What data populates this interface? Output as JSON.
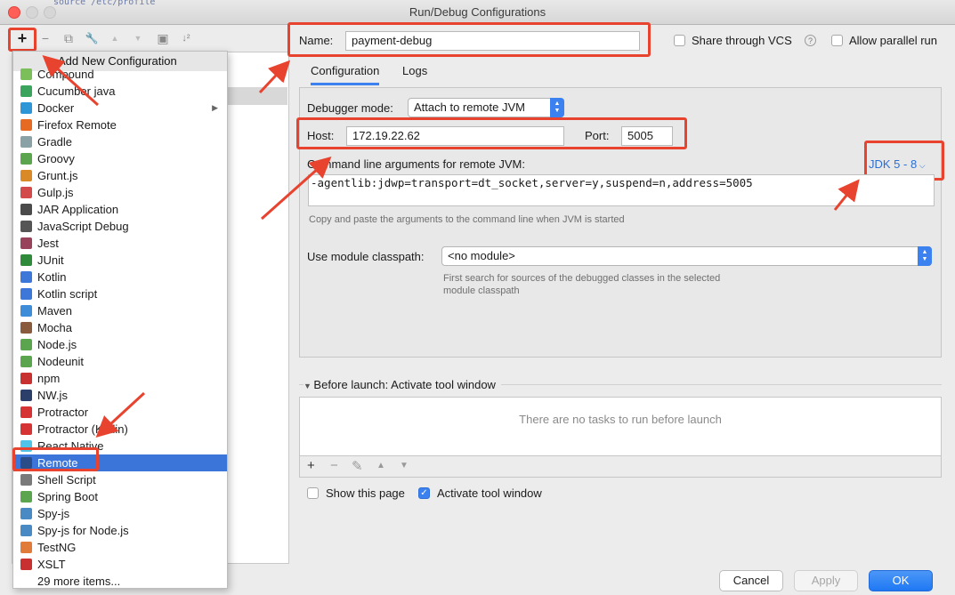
{
  "window": {
    "title": "Run/Debug Configurations",
    "bg_text": "source /etc/profile"
  },
  "toolbar": {
    "add": "+",
    "remove": "−",
    "copy": "⧉",
    "wrench": "🔧",
    "up": "▲",
    "down": "▼",
    "folder": "▣",
    "sort": "↓²"
  },
  "dropdown": {
    "header": "Add New Configuration",
    "items": [
      {
        "label": "Compound",
        "icon": "compound-icon",
        "color": "#7bbf5a"
      },
      {
        "label": "Cucumber java",
        "icon": "cucumber-icon",
        "color": "#3aa35c"
      },
      {
        "label": "Docker",
        "icon": "docker-icon",
        "color": "#2c96d6",
        "submenu": "▶"
      },
      {
        "label": "Firefox Remote",
        "icon": "firefox-icon",
        "color": "#e76a22"
      },
      {
        "label": "Gradle",
        "icon": "gradle-icon",
        "color": "#8aa1a6"
      },
      {
        "label": "Groovy",
        "icon": "groovy-icon",
        "color": "#5aa54d"
      },
      {
        "label": "Grunt.js",
        "icon": "grunt-icon",
        "color": "#d98a26"
      },
      {
        "label": "Gulp.js",
        "icon": "gulp-icon",
        "color": "#d24a4a"
      },
      {
        "label": "JAR Application",
        "icon": "jar-icon",
        "color": "#4b4b4b"
      },
      {
        "label": "JavaScript Debug",
        "icon": "js-debug-icon",
        "color": "#555"
      },
      {
        "label": "Jest",
        "icon": "jest-icon",
        "color": "#99425b"
      },
      {
        "label": "JUnit",
        "icon": "junit-icon",
        "color": "#2f8a3a"
      },
      {
        "label": "Kotlin",
        "icon": "kotlin-icon",
        "color": "#3d78d8"
      },
      {
        "label": "Kotlin script",
        "icon": "kotlin-script-icon",
        "color": "#3d78d8"
      },
      {
        "label": "Maven",
        "icon": "maven-icon",
        "color": "#3d8dd8"
      },
      {
        "label": "Mocha",
        "icon": "mocha-icon",
        "color": "#8a5a3c"
      },
      {
        "label": "Node.js",
        "icon": "nodejs-icon",
        "color": "#5aa54d"
      },
      {
        "label": "Nodeunit",
        "icon": "nodeunit-icon",
        "color": "#5aa54d"
      },
      {
        "label": "npm",
        "icon": "npm-icon",
        "color": "#c93030"
      },
      {
        "label": "NW.js",
        "icon": "nwjs-icon",
        "color": "#2c3e6a"
      },
      {
        "label": "Protractor",
        "icon": "protractor-icon",
        "color": "#d63434"
      },
      {
        "label": "Protractor (Kotlin)",
        "icon": "protractor-kotlin-icon",
        "color": "#d63434"
      },
      {
        "label": "React Native",
        "icon": "react-icon",
        "color": "#4fc3e8"
      },
      {
        "label": "Remote",
        "icon": "remote-icon",
        "color": "#2a4d8a",
        "selected": true
      },
      {
        "label": "Shell Script",
        "icon": "shell-icon",
        "color": "#7a7a7a"
      },
      {
        "label": "Spring Boot",
        "icon": "spring-icon",
        "color": "#5aa54d"
      },
      {
        "label": "Spy-js",
        "icon": "spyjs-icon",
        "color": "#4a8ac4"
      },
      {
        "label": "Spy-js for Node.js",
        "icon": "spyjs-node-icon",
        "color": "#4a8ac4"
      },
      {
        "label": "TestNG",
        "icon": "testng-icon",
        "color": "#e07b3a"
      },
      {
        "label": "XSLT",
        "icon": "xslt-icon",
        "color": "#c93030"
      },
      {
        "label": "29 more items...",
        "icon": "",
        "color": ""
      }
    ]
  },
  "name_row": {
    "label": "Name:",
    "value": "payment-debug",
    "share_vcs": "Share through VCS",
    "help": "?",
    "allow_parallel": "Allow parallel run"
  },
  "tabs": [
    {
      "label": "Configuration"
    },
    {
      "label": "Logs"
    }
  ],
  "config": {
    "debugger_mode_label": "Debugger mode:",
    "debugger_mode_value": "Attach to remote JVM",
    "host_label": "Host:",
    "host_value": "172.19.22.62",
    "port_label": "Port:",
    "port_value": "5005",
    "cmd_label": "Command line arguments for remote JVM:",
    "jdk_link": "JDK 5 - 8",
    "cmd_value": "-agentlib:jdwp=transport=dt_socket,server=y,suspend=n,address=5005",
    "cmd_hint": "Copy and paste the arguments to the command line when JVM is started",
    "module_label": "Use module classpath:",
    "module_value": "<no module>",
    "module_hint_1": "First search for sources of the debugged classes in the selected",
    "module_hint_2": "module classpath"
  },
  "before_launch": {
    "title": "Before launch: Activate tool window",
    "empty": "There are no tasks to run before launch",
    "add": "+",
    "remove": "−",
    "edit": "✎",
    "up": "▲",
    "down": "▼"
  },
  "options": {
    "show_page": "Show this page",
    "activate_tool": "Activate tool window",
    "activate_checked": "✓"
  },
  "buttons": {
    "cancel": "Cancel",
    "apply": "Apply",
    "ok": "OK"
  }
}
